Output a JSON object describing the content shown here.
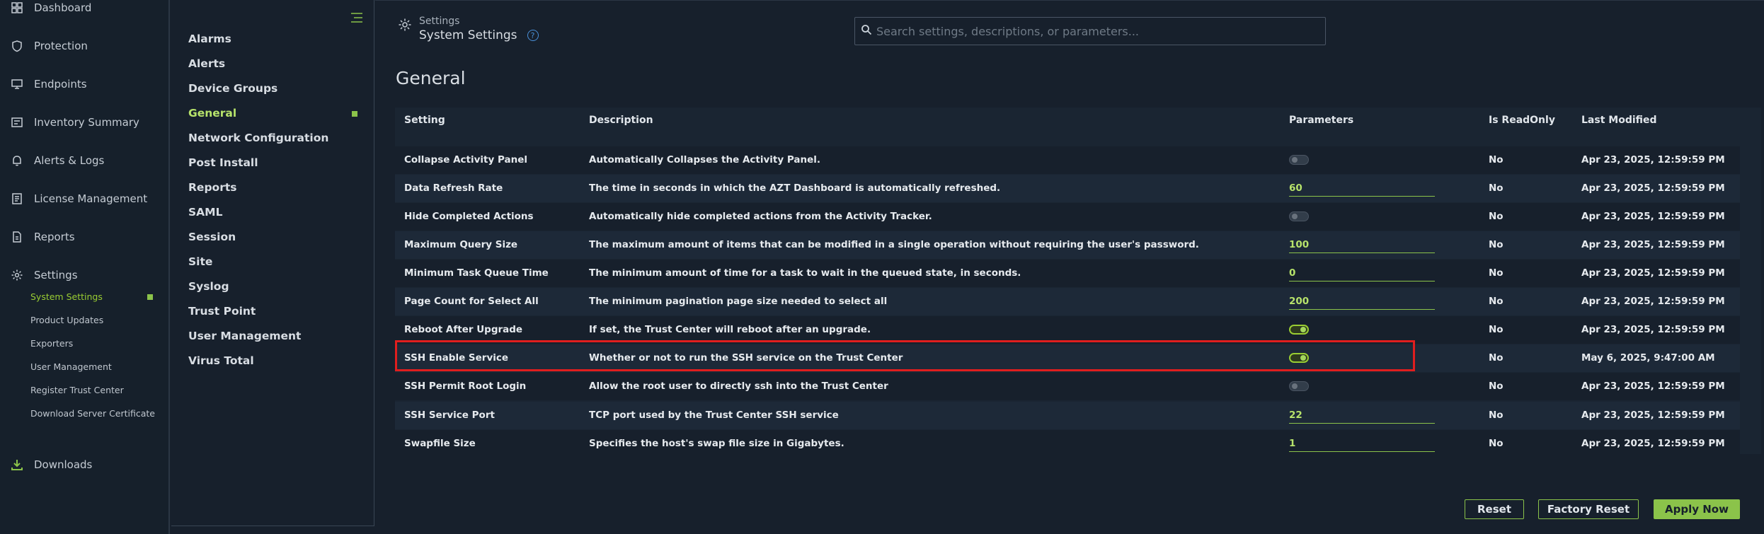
{
  "sidebar": {
    "items": [
      {
        "label": "Dashboard",
        "icon": "dashboard-icon"
      },
      {
        "label": "Protection",
        "icon": "shield-icon"
      },
      {
        "label": "Endpoints",
        "icon": "endpoints-icon"
      },
      {
        "label": "Inventory Summary",
        "icon": "inventory-icon"
      },
      {
        "label": "Alerts & Logs",
        "icon": "bell-icon"
      },
      {
        "label": "License Management",
        "icon": "license-icon"
      },
      {
        "label": "Reports",
        "icon": "report-icon"
      },
      {
        "label": "Settings",
        "icon": "gear-icon"
      }
    ],
    "subitems": [
      {
        "label": "System Settings",
        "active": true
      },
      {
        "label": "Product Updates"
      },
      {
        "label": "Exporters"
      },
      {
        "label": "User Management"
      },
      {
        "label": "Register Trust Center"
      },
      {
        "label": "Download Server Certificate"
      }
    ],
    "downloads": {
      "label": "Downloads",
      "icon": "download-icon"
    }
  },
  "categories": [
    "Alarms",
    "Alerts",
    "Device Groups",
    "General",
    "Network Configuration",
    "Post Install",
    "Reports",
    "SAML",
    "Session",
    "Site",
    "Syslog",
    "Trust Point",
    "User Management",
    "Virus Total"
  ],
  "active_category": "General",
  "breadcrumb": {
    "parent": "Settings",
    "current": "System Settings"
  },
  "search": {
    "placeholder": "Search settings, descriptions, or parameters..."
  },
  "page_title": "General",
  "table": {
    "headers": [
      "Setting",
      "Description",
      "Parameters",
      "Is ReadOnly",
      "Last Modified"
    ],
    "rows": [
      {
        "setting": "Collapse Activity Panel",
        "description": "Automatically Collapses the Activity Panel.",
        "param_type": "toggle",
        "value": "off",
        "readonly": "No",
        "modified": "Apr 23, 2025, 12:59:59 PM"
      },
      {
        "setting": "Data Refresh Rate",
        "description": "The time in seconds in which the AZT Dashboard is automatically refreshed.",
        "param_type": "number",
        "value": "60",
        "readonly": "No",
        "modified": "Apr 23, 2025, 12:59:59 PM"
      },
      {
        "setting": "Hide Completed Actions",
        "description": "Automatically hide completed actions from the Activity Tracker.",
        "param_type": "toggle",
        "value": "off",
        "readonly": "No",
        "modified": "Apr 23, 2025, 12:59:59 PM"
      },
      {
        "setting": "Maximum Query Size",
        "description": "The maximum amount of items that can be modified in a single operation without requiring the user's password.",
        "param_type": "number",
        "value": "100",
        "readonly": "No",
        "modified": "Apr 23, 2025, 12:59:59 PM"
      },
      {
        "setting": "Minimum Task Queue Time",
        "description": "The minimum amount of time for a task to wait in the queued state, in seconds.",
        "param_type": "number",
        "value": "0",
        "readonly": "No",
        "modified": "Apr 23, 2025, 12:59:59 PM"
      },
      {
        "setting": "Page Count for Select All",
        "description": "The minimum pagination page size needed to select all",
        "param_type": "number",
        "value": "200",
        "readonly": "No",
        "modified": "Apr 23, 2025, 12:59:59 PM"
      },
      {
        "setting": "Reboot After Upgrade",
        "description": "If set, the Trust Center will reboot after an upgrade.",
        "param_type": "toggle",
        "value": "on",
        "readonly": "No",
        "modified": "Apr 23, 2025, 12:59:59 PM"
      },
      {
        "setting": "SSH Enable Service",
        "description": "Whether or not to run the SSH service on the Trust Center",
        "param_type": "toggle",
        "value": "on",
        "readonly": "No",
        "modified": "May 6, 2025, 9:47:00 AM"
      },
      {
        "setting": "SSH Permit Root Login",
        "description": "Allow the root user to directly ssh into the Trust Center",
        "param_type": "toggle",
        "value": "off",
        "readonly": "No",
        "modified": "Apr 23, 2025, 12:59:59 PM"
      },
      {
        "setting": "SSH Service Port",
        "description": "TCP port used by the Trust Center SSH service",
        "param_type": "number",
        "value": "22",
        "readonly": "No",
        "modified": "Apr 23, 2025, 12:59:59 PM"
      },
      {
        "setting": "Swapfile Size",
        "description": "Specifies the host's swap file size in Gigabytes.",
        "param_type": "number",
        "value": "1",
        "readonly": "No",
        "modified": "Apr 23, 2025, 12:59:59 PM"
      }
    ]
  },
  "buttons": {
    "reset": "Reset",
    "factory_reset": "Factory Reset",
    "apply": "Apply Now"
  },
  "colors": {
    "accent": "#8bc34a",
    "highlight": "#e01e1e",
    "background": "#17202c"
  }
}
